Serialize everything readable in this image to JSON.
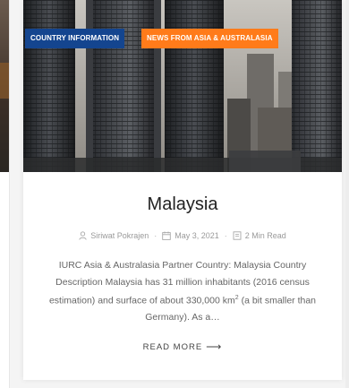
{
  "card": {
    "tags": {
      "country": "COUNTRY INFORMATION",
      "news": "NEWS FROM ASIA & AUSTRALASIA"
    },
    "title": "Malaysia",
    "meta": {
      "author": "Siriwat Pokrajen",
      "date": "May 3, 2021",
      "read_time": "2 Min Read"
    },
    "excerpt": {
      "lead": "IURC Asia & Australasia Partner Country: Malaysia Country Description Malaysia has 31 million inhabitants (2016 census estimation) and surface of about 330,000 km",
      "superscript": "2",
      "tail": " (a bit smaller than Germany). As a…"
    },
    "read_more": "READ MORE",
    "read_more_arrow": "⟶"
  },
  "colors": {
    "tag_country_bg": "#14458f",
    "tag_news_bg": "#ff7b1a",
    "title": "#222222",
    "meta": "#9a9a9a",
    "excerpt": "#666666"
  },
  "icons": {
    "author": "user-icon",
    "date": "calendar-icon",
    "read_time": "book-icon"
  }
}
